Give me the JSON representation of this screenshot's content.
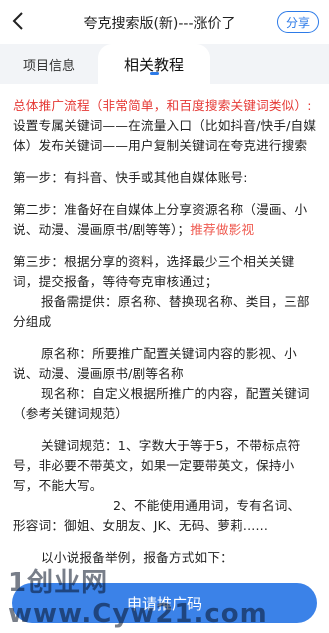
{
  "header": {
    "title": "夸克搜索版(新)---涨价了",
    "share_label": "分享"
  },
  "tabs": [
    {
      "label": "项目信息"
    },
    {
      "label": "相关教程"
    }
  ],
  "content": {
    "heading": "总体推广流程（非常简单，和百度搜索关键词类似）:",
    "intro": "设置专属关键词——在流量入口（比如抖音/快手/自媒体）发布关键词——用户复制关键词在夸克进行搜索",
    "step1": "第一步：有抖音、快手或其他自媒体账号:",
    "step2_text": "第二步：准备好在自媒体上分享资源名称（漫画、小说、动漫、漫画原书/剧等等）；",
    "step2_link": "推荐做影视",
    "step3": "第三步：根据分享的资料，选择最少三个相关关键词，提交报备，等待夸克审核通过；",
    "report_need": "报备需提供：原名称、替换现名称、类目，三部分组成",
    "original_name": "原名称：所要推广配置关键词内容的影视、小说、动漫、漫画原书/剧等名称",
    "current_name": "现名称：自定义根据所推广的内容，配置关键词（参考关键词规范）",
    "rule1": "关键词规范：1、字数大于等于5，不带标点符号，非必要不带英文，如果一定要带英文，保持小写，不能大写。",
    "rule2_a": "2、不能使用通用词，专有名词、",
    "rule2_b": "形容词：御姐、女朋友、JK、无码、萝莉......",
    "example": "以小说报备举例，报备方式如下："
  },
  "apply_label": "申请推广码",
  "watermark": "1创业网 www.Cyw21.com",
  "colors": {
    "accent": "#2d7be8",
    "button": "#3b82e8",
    "heading_red": "#e53935"
  }
}
